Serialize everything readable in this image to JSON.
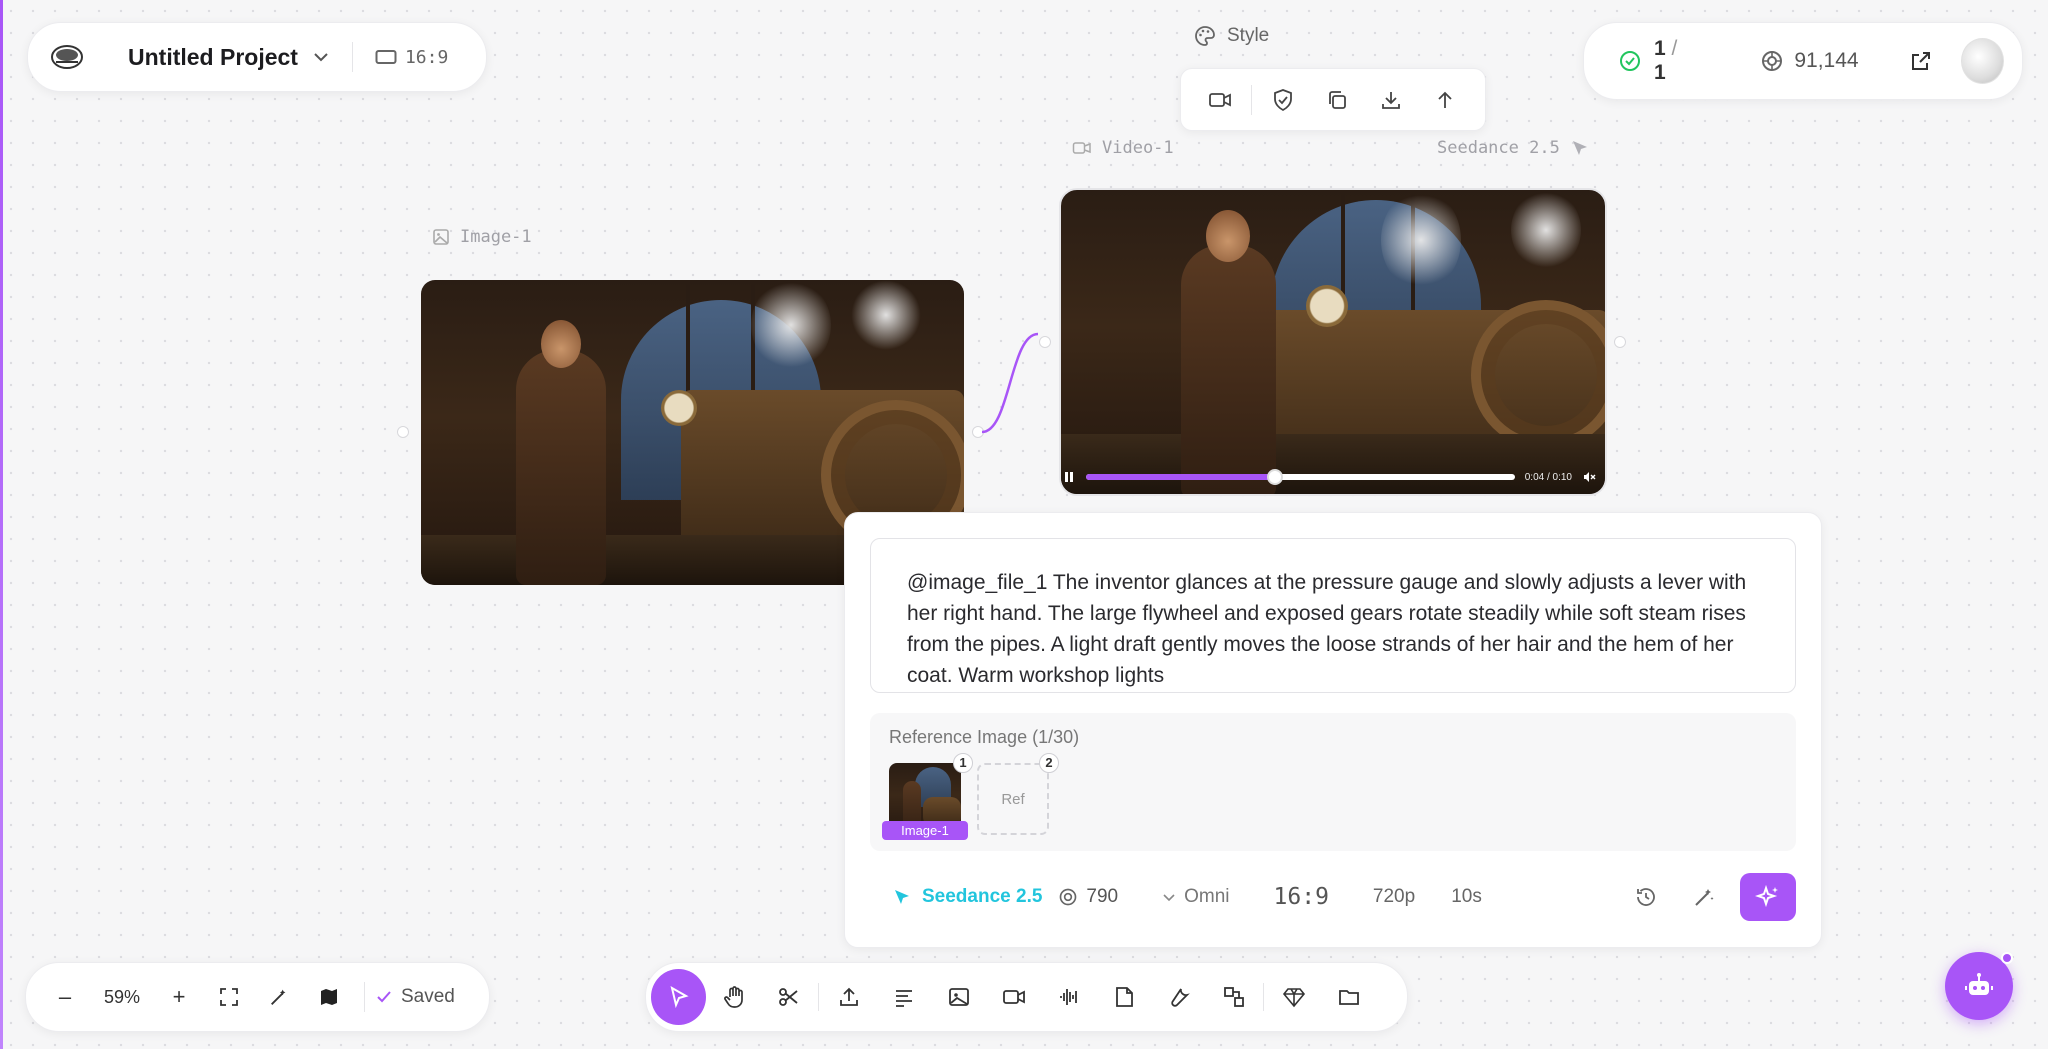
{
  "project": {
    "title": "Untitled Project",
    "aspect_ratio": "16:9"
  },
  "status": {
    "tasks_done": "1",
    "tasks_total": "1",
    "credits": "91,144"
  },
  "canvas": {
    "style_label": "Style",
    "image_node": {
      "label": "Image-1"
    },
    "video_node": {
      "label": "Video-1",
      "model": "Seedance 2.5",
      "time": "0:04 / 0:10",
      "progress": 0.44
    }
  },
  "prompt": {
    "text": "@image_file_1 The inventor glances at the pressure gauge and slowly adjusts a lever with her right hand. The large flywheel and exposed gears rotate steadily while soft steam rises from the pipes. A light draft gently moves the loose strands of her hair and the hem of her coat. Warm workshop lights",
    "reference_title": "Reference Image (1/30)",
    "reference_items": [
      {
        "badge": "1",
        "label": "Image-1"
      },
      {
        "badge": "2",
        "label": "Ref"
      }
    ]
  },
  "options": {
    "model": "Seedance 2.5",
    "cost": "790",
    "mode": "Omni",
    "ratio": "16:9",
    "resolution": "720p",
    "duration": "10s"
  },
  "zoom": {
    "level": "59%",
    "minus": "–",
    "plus": "+",
    "saved": "Saved"
  },
  "colors": {
    "accent": "#a855f7",
    "model": "#22c5dd",
    "success": "#22c55e"
  }
}
